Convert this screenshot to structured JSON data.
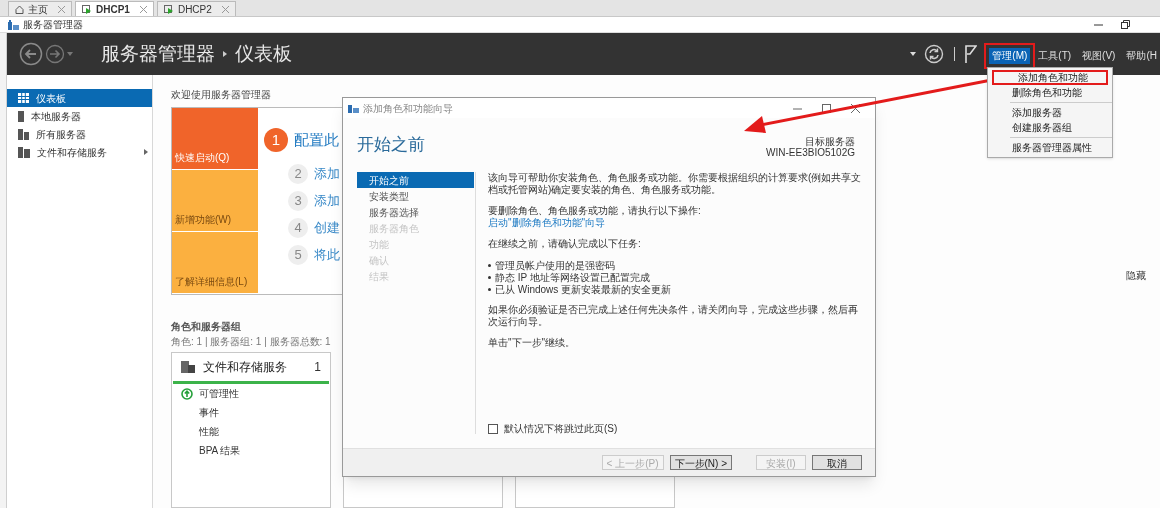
{
  "vm_tabs": [
    {
      "label": "主页",
      "kind": "home",
      "selected": false
    },
    {
      "label": "DHCP1",
      "kind": "vm",
      "selected": true
    },
    {
      "label": "DHCP2",
      "kind": "vm",
      "selected": false
    }
  ],
  "window": {
    "title": "服务器管理器"
  },
  "header": {
    "breadcrumb": [
      "服务器管理器",
      "仪表板"
    ],
    "menus": [
      {
        "label": "管理(M)",
        "selected": true,
        "annotated": true
      },
      {
        "label": "工具(T)",
        "selected": false,
        "annotated": false
      },
      {
        "label": "视图(V)",
        "selected": false,
        "annotated": false
      },
      {
        "label": "帮助(H",
        "selected": false,
        "annotated": false
      }
    ]
  },
  "menu_dropdown": {
    "groups": [
      [
        {
          "label": "添加角色和功能",
          "annotated": true
        },
        {
          "label": "删除角色和功能",
          "annotated": false
        }
      ],
      [
        {
          "label": "添加服务器",
          "annotated": false
        },
        {
          "label": "创建服务器组",
          "annotated": false
        }
      ],
      [
        {
          "label": "服务器管理器属性",
          "annotated": false
        }
      ]
    ]
  },
  "sidebar": {
    "items": [
      {
        "label": "仪表板",
        "kind": "dashboard",
        "selected": true,
        "has_submenu": false
      },
      {
        "label": "本地服务器",
        "kind": "server",
        "selected": false,
        "has_submenu": false
      },
      {
        "label": "所有服务器",
        "kind": "servers",
        "selected": false,
        "has_submenu": false
      },
      {
        "label": "文件和存储服务",
        "kind": "storage",
        "selected": false,
        "has_submenu": true
      }
    ]
  },
  "welcome": {
    "title": "欢迎使用服务器管理器",
    "tiles": [
      {
        "label": "快速启动(Q)",
        "color": "#f0642a"
      },
      {
        "label": "新增功能(W)",
        "color": "#fbb040"
      },
      {
        "label": "了解详细信息(L)",
        "color": "#fbb040"
      }
    ],
    "steps": [
      {
        "number": "1",
        "label": "配置此",
        "active": true
      },
      {
        "number": "2",
        "label": "添加",
        "active": false
      },
      {
        "number": "3",
        "label": "添加",
        "active": false
      },
      {
        "number": "4",
        "label": "创建",
        "active": false
      },
      {
        "number": "5",
        "label": "将此",
        "active": false
      }
    ],
    "hide_link": "隐藏"
  },
  "roles": {
    "title": "角色和服务器组",
    "summary": "角色: 1 | 服务器组: 1 | 服务器总数: 1",
    "cards": [
      {
        "title": "文件和存储服务",
        "count": "1",
        "items": [
          {
            "label": "可管理性",
            "kind": "status"
          },
          {
            "label": "事件",
            "kind": "plain"
          },
          {
            "label": "性能",
            "kind": "plain"
          },
          {
            "label": "BPA 结果",
            "kind": "plain"
          }
        ]
      }
    ]
  },
  "dialog": {
    "title": "添加角色和功能向导",
    "heading": "开始之前",
    "target_label": "目标服务器",
    "target_server": "WIN-EE3BIO5102G",
    "nav": [
      {
        "label": "开始之前",
        "selected": true,
        "disabled": false
      },
      {
        "label": "安装类型",
        "selected": false,
        "disabled": false
      },
      {
        "label": "服务器选择",
        "selected": false,
        "disabled": false
      },
      {
        "label": "服务器角色",
        "selected": false,
        "disabled": true
      },
      {
        "label": "功能",
        "selected": false,
        "disabled": true
      },
      {
        "label": "确认",
        "selected": false,
        "disabled": true
      },
      {
        "label": "结果",
        "selected": false,
        "disabled": true
      }
    ],
    "blocks": [
      {
        "kind": "paragraph",
        "text": "该向导可帮助你安装角色、角色服务或功能。你需要根据组织的计算要求(例如共享文档或托管网站)确定要安装的角色、角色服务或功能。"
      },
      {
        "kind": "paragraph",
        "text": "要删除角色、角色服务或功能，请执行以下操作:"
      },
      {
        "kind": "link",
        "text": "启动\"删除角色和功能\"向导"
      },
      {
        "kind": "paragraph",
        "text": "在继续之前，请确认完成以下任务:"
      },
      {
        "kind": "bullets",
        "items": [
          "管理员帐户使用的是强密码",
          "静态 IP 地址等网络设置已配置完成",
          "已从 Windows 更新安装最新的安全更新"
        ]
      },
      {
        "kind": "paragraph",
        "text": "如果你必须验证是否已完成上述任何先决条件，请关闭向导，完成这些步骤，然后再次运行向导。"
      },
      {
        "kind": "paragraph",
        "text": "单击\"下一步\"继续。"
      }
    ],
    "skip_checkbox": {
      "label": "默认情况下将跳过此页(S)",
      "checked": false
    },
    "buttons": [
      {
        "label": "< 上一步(P)",
        "disabled": true
      },
      {
        "label": "下一步(N) >",
        "disabled": false
      },
      {
        "label": "安装(I)",
        "disabled": true
      },
      {
        "label": "取消",
        "disabled": false
      }
    ]
  }
}
